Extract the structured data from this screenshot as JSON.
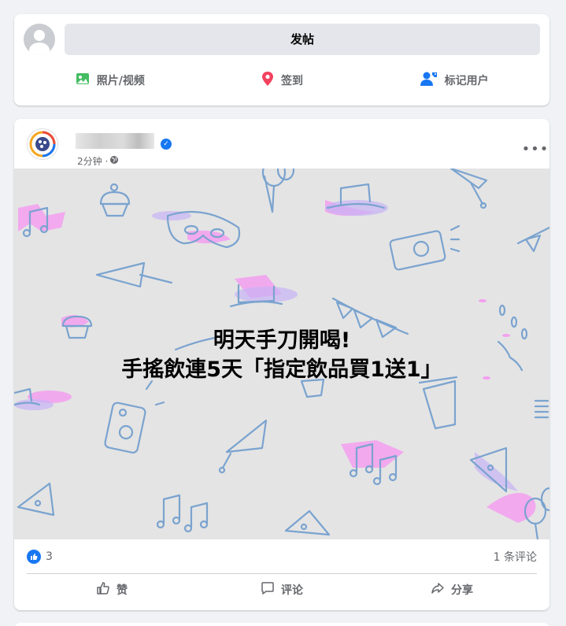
{
  "composer": {
    "post_label": "发帖",
    "actions": [
      {
        "label": "照片/视频",
        "icon": "photo-video-icon",
        "color": "#45bd62"
      },
      {
        "label": "签到",
        "icon": "location-pin-icon",
        "color": "#f3425f"
      },
      {
        "label": "标记用户",
        "icon": "tag-people-icon",
        "color": "#1877f2"
      }
    ]
  },
  "post": {
    "time": "2分钟 ·",
    "overlay_line1": "明天手刀開喝!",
    "overlay_line2": "手搖飲連5天「指定飲品買1送1」",
    "like_count": "3",
    "comment_count": "1 条评论",
    "buttons": {
      "like": "赞",
      "comment": "评论",
      "share": "分享"
    }
  },
  "colors": {
    "accent": "#1877f2",
    "text_secondary": "#65676b",
    "background": "#f0f2f5"
  }
}
